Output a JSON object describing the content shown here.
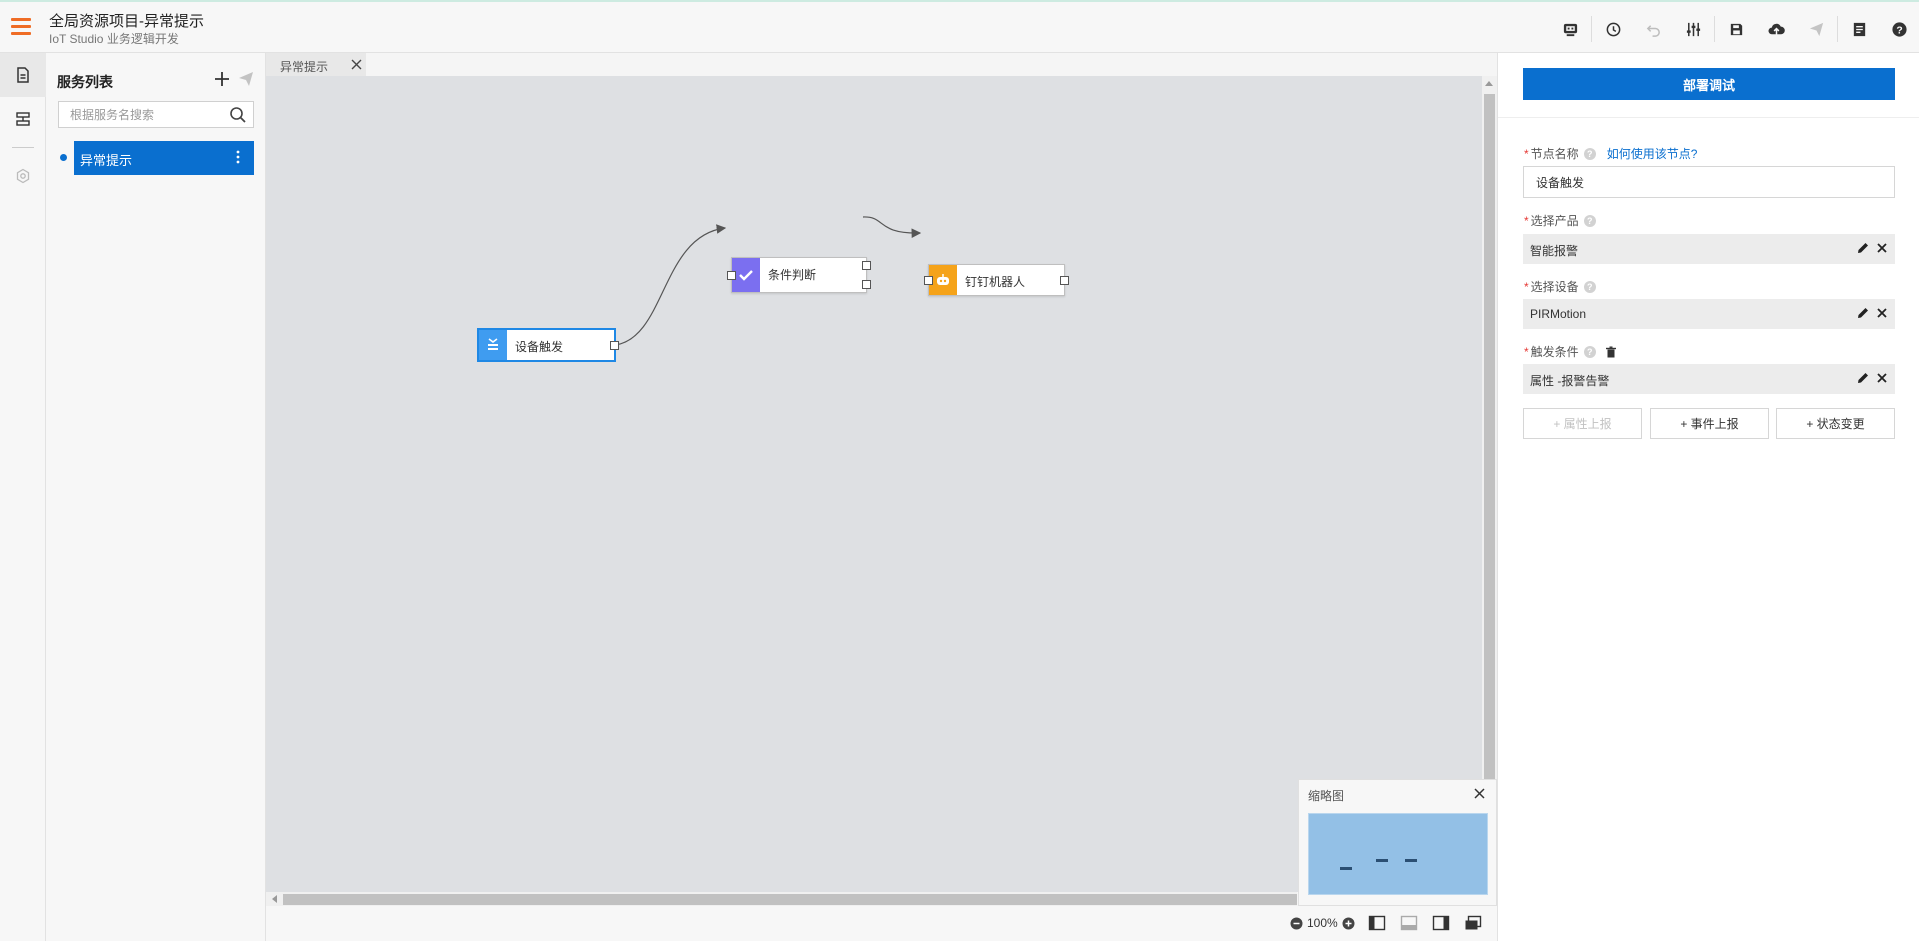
{
  "header": {
    "title": "全局资源项目-异常提示",
    "subtitle": "IoT Studio 业务逻辑开发",
    "toolbar": [
      {
        "icon": "debug-console-icon",
        "enabled": true
      },
      {
        "icon": "history-clock-icon",
        "enabled": true
      },
      {
        "icon": "undo-icon",
        "enabled": false
      },
      {
        "icon": "settings-sliders-icon",
        "enabled": true
      },
      {
        "icon": "save-icon",
        "enabled": true
      },
      {
        "icon": "cloud-deploy-icon",
        "enabled": true
      },
      {
        "icon": "publish-send-icon",
        "enabled": false
      },
      {
        "icon": "document-icon",
        "enabled": true
      },
      {
        "icon": "help-icon",
        "enabled": true
      }
    ]
  },
  "rail": {
    "items": [
      {
        "icon": "file-icon",
        "active": true
      },
      {
        "icon": "storage-icon",
        "active": false
      },
      {
        "icon": "settings-hex-icon",
        "active": false
      }
    ]
  },
  "service_panel": {
    "title": "服务列表",
    "search_placeholder": "根据服务名搜索",
    "services": [
      {
        "label": "异常提示",
        "selected": true
      }
    ]
  },
  "canvas": {
    "tab_label": "异常提示",
    "nodes": [
      {
        "id": "trigger",
        "label": "设备触发",
        "icon": "device-trigger-icon",
        "color": "#3f9cf0"
      },
      {
        "id": "condition",
        "label": "条件判断",
        "icon": "check-icon",
        "color": "#7b6ff0"
      },
      {
        "id": "dingtalk",
        "label": "钉钉机器人",
        "icon": "robot-icon",
        "color": "#f5a31a"
      }
    ],
    "zoom": "100%",
    "minimap_title": "缩略图"
  },
  "properties": {
    "deploy_button": "部署调试",
    "node_name_label": "节点名称",
    "node_help_link": "如何使用该节点?",
    "node_name_value": "设备触发",
    "product_label": "选择产品",
    "product_value": "智能报警",
    "device_label": "选择设备",
    "device_value": "PIRMotion",
    "trigger_label": "触发条件",
    "trigger_value": "属性 -报警告警",
    "add_buttons": [
      {
        "label": "+ 属性上报",
        "enabled": false
      },
      {
        "label": "+ 事件上报",
        "enabled": true
      },
      {
        "label": "+ 状态变更",
        "enabled": true
      }
    ]
  },
  "colors": {
    "primary": "#0a6fcf",
    "menu_accent": "#ef6c25",
    "canvas_bg": "#dee0e3",
    "required_mark": "#e53935"
  }
}
